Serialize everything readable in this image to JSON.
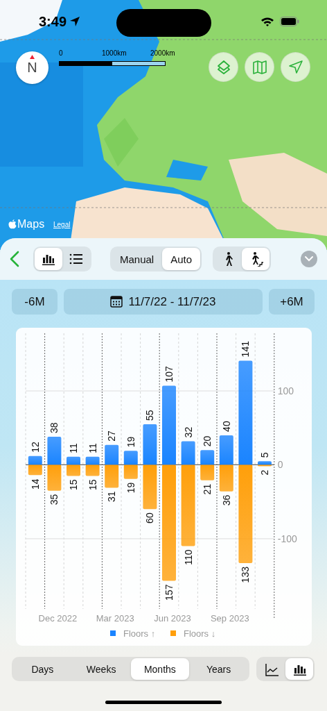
{
  "status_bar": {
    "time": "3:49"
  },
  "map": {
    "kind": "picture",
    "compass": "N",
    "scale_labels": [
      "0",
      "1000km",
      "2000km"
    ],
    "attribution": "Maps",
    "legal_link": "Legal"
  },
  "toolbar": {
    "view_modes": [
      {
        "kind": "chart",
        "selected": true
      },
      {
        "kind": "list",
        "selected": false
      }
    ],
    "modes": [
      {
        "label": "Manual",
        "selected": false
      },
      {
        "label": "Auto",
        "selected": true
      }
    ],
    "activities": [
      {
        "kind": "walk",
        "selected": false
      },
      {
        "kind": "stairs",
        "selected": true
      }
    ]
  },
  "date_range": {
    "back": "-6M",
    "range": "11/7/22 - 11/7/23",
    "forward": "+6M"
  },
  "chart": {
    "chart_data": {
      "type": "bar",
      "stacked": true,
      "categories": [
        null,
        "Dec 2022",
        null,
        null,
        "Mar 2023",
        null,
        null,
        "Jun 2023",
        null,
        null,
        "Sep 2023",
        null,
        null
      ],
      "yticks": [
        -100,
        0,
        100
      ],
      "ylim": [
        -195,
        178
      ],
      "legend": "bottom",
      "series": [
        {
          "name": "Floors ↑",
          "color": "#1a84ff",
          "values": [
            12,
            38,
            11,
            11,
            27,
            19,
            55,
            107,
            32,
            20,
            40,
            141,
            5
          ]
        },
        {
          "name": "Floors ↓",
          "color": "#ff9f0a",
          "values": [
            -14,
            -35,
            -15,
            -15,
            -31,
            -19,
            -60,
            -157,
            -110,
            -21,
            -36,
            -133,
            -2
          ]
        }
      ],
      "value_labels": [
        [
          "12",
          "38",
          "11",
          "11",
          "27",
          "19",
          "55",
          "107",
          "32",
          "20",
          "40",
          "141",
          "5"
        ],
        [
          "14",
          "35",
          "15",
          "15",
          "31",
          "19",
          "60",
          "157",
          "110",
          "21",
          "36",
          "133",
          "2"
        ]
      ]
    }
  },
  "periods": [
    {
      "label": "Days",
      "selected": false
    },
    {
      "label": "Weeks",
      "selected": false
    },
    {
      "label": "Months",
      "selected": true
    },
    {
      "label": "Years",
      "selected": false
    }
  ],
  "chart_types": [
    {
      "kind": "line",
      "selected": false
    },
    {
      "kind": "bar",
      "selected": true
    }
  ]
}
